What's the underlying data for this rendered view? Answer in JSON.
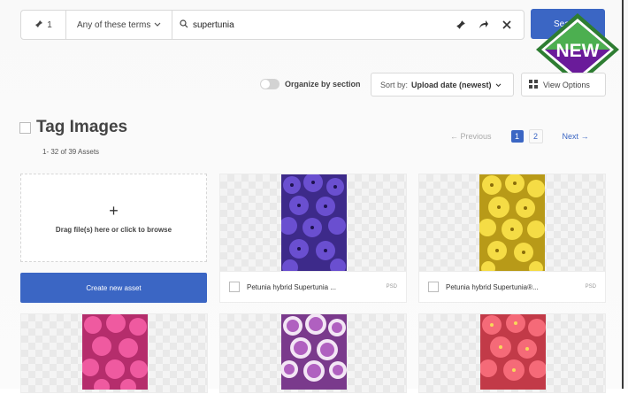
{
  "search": {
    "pin_count": "1",
    "match_mode": "Any of these terms",
    "query": "supertunia",
    "button_label": "Search"
  },
  "badge": {
    "label": "NEW",
    "colors": {
      "border": "#4caf50",
      "fill": "#6a1b9a"
    }
  },
  "toolbar": {
    "organize_label": "Organize by section",
    "organize_on": false,
    "sort_prefix": "Sort by:",
    "sort_value": "Upload date (newest)",
    "view_options_label": "View Options"
  },
  "header": {
    "title": "Tag Images",
    "count": "1- 32 of 39 Assets"
  },
  "pagination": {
    "previous": "Previous",
    "pages": [
      "1",
      "2"
    ],
    "current": "1",
    "next": "Next"
  },
  "upload": {
    "drop_label": "Drag file(s) here or click to browse",
    "create_label": "Create new asset"
  },
  "assets": [
    {
      "name": "Petunia hybrid Supertunia ...",
      "type": "PSD",
      "color": "#5a3fb0"
    },
    {
      "name": "Petunia hybrid Supertunia®...",
      "type": "PSD",
      "color": "#f2d43a"
    },
    {
      "name": "",
      "type": "",
      "color": "#e0488e"
    },
    {
      "name": "",
      "type": "",
      "color": "#b060c0"
    },
    {
      "name": "",
      "type": "",
      "color": "#ef5a6a"
    }
  ],
  "colors": {
    "accent": "#3b66c4"
  }
}
